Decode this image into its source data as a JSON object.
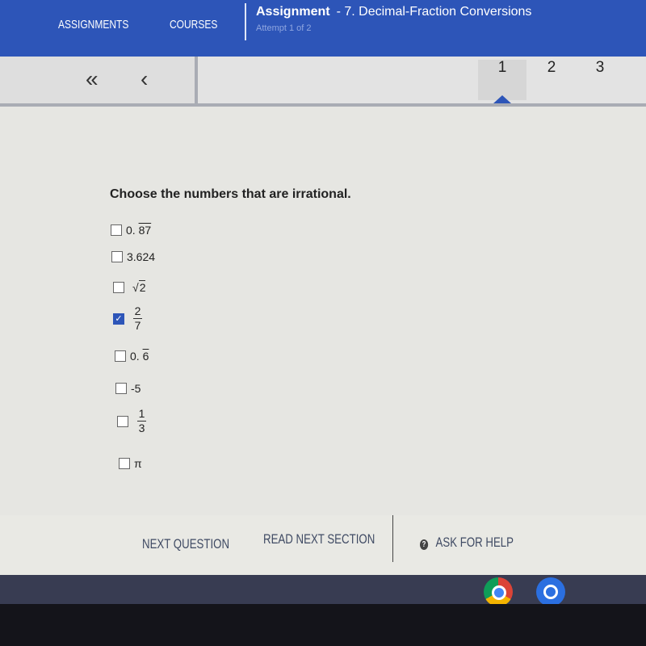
{
  "header": {
    "nav": [
      "ASSIGNMENTS",
      "COURSES"
    ],
    "title_label": "Assignment",
    "title": "- 7. Decimal-Fraction Conversions",
    "attempt": "Attempt 1 of 2"
  },
  "toolbar": {
    "first_icon": "«",
    "prev_icon": "‹",
    "pages": [
      "1",
      "2",
      "3"
    ],
    "active_page": "1"
  },
  "question": {
    "prompt": "Choose the numbers that are irrational.",
    "options": [
      {
        "prefix": "0.",
        "repeat": "87",
        "checked": false
      },
      {
        "text": "3.624",
        "checked": false
      },
      {
        "sqrt": "2",
        "checked": false
      },
      {
        "num": "2",
        "den": "7",
        "checked": true
      },
      {
        "prefix": "0.",
        "repeat": "6",
        "checked": false
      },
      {
        "text": "-5",
        "checked": false
      },
      {
        "num": "1",
        "den": "3",
        "checked": false
      },
      {
        "text": "π",
        "checked": false
      }
    ]
  },
  "footer": {
    "next_question": "NEXT QUESTION",
    "read_next": "READ NEXT SECTION",
    "help_icon": "?",
    "ask_help": "ASK FOR HELP"
  },
  "taskbar": {
    "apps": [
      "chrome-icon",
      "quizlet-icon"
    ]
  },
  "colors": {
    "brand": "#2d55b8",
    "checked": "#2d55b8"
  }
}
